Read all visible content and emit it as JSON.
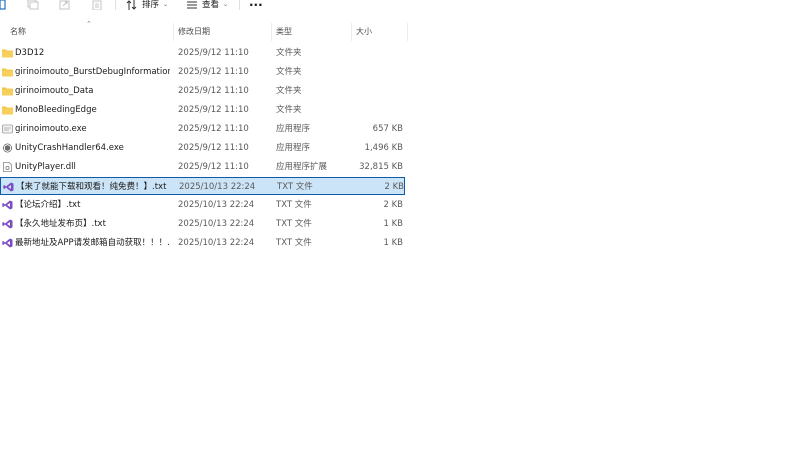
{
  "toolbar": {
    "sort_label": "排序",
    "view_label": "查看",
    "more_label": "···"
  },
  "columns": {
    "name": "名称",
    "date": "修改日期",
    "type": "类型",
    "size": "大小"
  },
  "files": [
    {
      "name": "D3D12",
      "date": "2025/9/12 11:10",
      "type": "文件夹",
      "size": "",
      "icon": "folder-icon"
    },
    {
      "name": "girinoimouto_BurstDebugInformation...",
      "date": "2025/9/12 11:10",
      "type": "文件夹",
      "size": "",
      "icon": "folder-icon"
    },
    {
      "name": "girinoimouto_Data",
      "date": "2025/9/12 11:10",
      "type": "文件夹",
      "size": "",
      "icon": "folder-icon"
    },
    {
      "name": "MonoBleedingEdge",
      "date": "2025/9/12 11:10",
      "type": "文件夹",
      "size": "",
      "icon": "folder-icon"
    },
    {
      "name": "girinoimouto.exe",
      "date": "2025/9/12 11:10",
      "type": "应用程序",
      "size": "657 KB",
      "icon": "app-icon"
    },
    {
      "name": "UnityCrashHandler64.exe",
      "date": "2025/9/12 11:10",
      "type": "应用程序",
      "size": "1,496 KB",
      "icon": "unity-icon"
    },
    {
      "name": "UnityPlayer.dll",
      "date": "2025/9/12 11:10",
      "type": "应用程序扩展",
      "size": "32,815 KB",
      "icon": "dll-icon"
    },
    {
      "name": "【来了就能下载和观看！纯免费！】.txt",
      "date": "2025/10/13 22:24",
      "type": "TXT 文件",
      "size": "2 KB",
      "icon": "visual-studio-icon",
      "selected": true
    },
    {
      "name": "【论坛介绍】.txt",
      "date": "2025/10/13 22:24",
      "type": "TXT 文件",
      "size": "2 KB",
      "icon": "visual-studio-icon"
    },
    {
      "name": "【永久地址发布页】.txt",
      "date": "2025/10/13 22:24",
      "type": "TXT 文件",
      "size": "1 KB",
      "icon": "visual-studio-icon"
    },
    {
      "name": "最新地址及APP请发邮箱自动获取！！！....",
      "date": "2025/10/13 22:24",
      "type": "TXT 文件",
      "size": "1 KB",
      "icon": "visual-studio-icon"
    }
  ],
  "colors": {
    "folder": "#f4c542",
    "vs_purple": "#7b4cc4",
    "selection_bg": "#cce4f7",
    "selection_border": "#0e5aa7"
  }
}
